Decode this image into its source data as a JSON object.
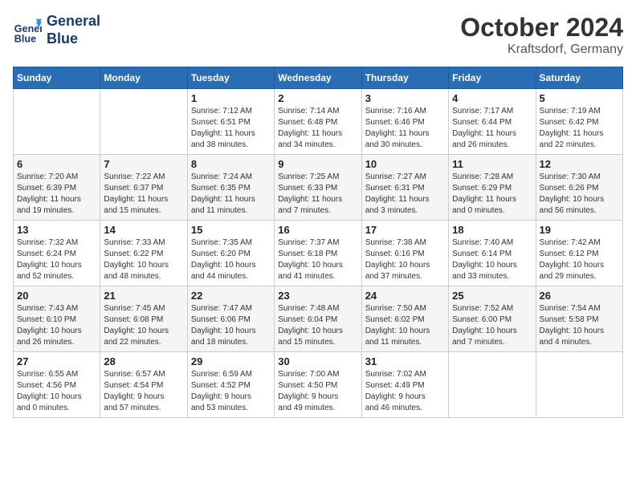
{
  "header": {
    "logo_line1": "General",
    "logo_line2": "Blue",
    "month_title": "October 2024",
    "location": "Kraftsdorf, Germany"
  },
  "weekdays": [
    "Sunday",
    "Monday",
    "Tuesday",
    "Wednesday",
    "Thursday",
    "Friday",
    "Saturday"
  ],
  "weeks": [
    [
      {
        "num": "",
        "info": ""
      },
      {
        "num": "",
        "info": ""
      },
      {
        "num": "1",
        "info": "Sunrise: 7:12 AM\nSunset: 6:51 PM\nDaylight: 11 hours\nand 38 minutes."
      },
      {
        "num": "2",
        "info": "Sunrise: 7:14 AM\nSunset: 6:48 PM\nDaylight: 11 hours\nand 34 minutes."
      },
      {
        "num": "3",
        "info": "Sunrise: 7:16 AM\nSunset: 6:46 PM\nDaylight: 11 hours\nand 30 minutes."
      },
      {
        "num": "4",
        "info": "Sunrise: 7:17 AM\nSunset: 6:44 PM\nDaylight: 11 hours\nand 26 minutes."
      },
      {
        "num": "5",
        "info": "Sunrise: 7:19 AM\nSunset: 6:42 PM\nDaylight: 11 hours\nand 22 minutes."
      }
    ],
    [
      {
        "num": "6",
        "info": "Sunrise: 7:20 AM\nSunset: 6:39 PM\nDaylight: 11 hours\nand 19 minutes."
      },
      {
        "num": "7",
        "info": "Sunrise: 7:22 AM\nSunset: 6:37 PM\nDaylight: 11 hours\nand 15 minutes."
      },
      {
        "num": "8",
        "info": "Sunrise: 7:24 AM\nSunset: 6:35 PM\nDaylight: 11 hours\nand 11 minutes."
      },
      {
        "num": "9",
        "info": "Sunrise: 7:25 AM\nSunset: 6:33 PM\nDaylight: 11 hours\nand 7 minutes."
      },
      {
        "num": "10",
        "info": "Sunrise: 7:27 AM\nSunset: 6:31 PM\nDaylight: 11 hours\nand 3 minutes."
      },
      {
        "num": "11",
        "info": "Sunrise: 7:28 AM\nSunset: 6:29 PM\nDaylight: 11 hours\nand 0 minutes."
      },
      {
        "num": "12",
        "info": "Sunrise: 7:30 AM\nSunset: 6:26 PM\nDaylight: 10 hours\nand 56 minutes."
      }
    ],
    [
      {
        "num": "13",
        "info": "Sunrise: 7:32 AM\nSunset: 6:24 PM\nDaylight: 10 hours\nand 52 minutes."
      },
      {
        "num": "14",
        "info": "Sunrise: 7:33 AM\nSunset: 6:22 PM\nDaylight: 10 hours\nand 48 minutes."
      },
      {
        "num": "15",
        "info": "Sunrise: 7:35 AM\nSunset: 6:20 PM\nDaylight: 10 hours\nand 44 minutes."
      },
      {
        "num": "16",
        "info": "Sunrise: 7:37 AM\nSunset: 6:18 PM\nDaylight: 10 hours\nand 41 minutes."
      },
      {
        "num": "17",
        "info": "Sunrise: 7:38 AM\nSunset: 6:16 PM\nDaylight: 10 hours\nand 37 minutes."
      },
      {
        "num": "18",
        "info": "Sunrise: 7:40 AM\nSunset: 6:14 PM\nDaylight: 10 hours\nand 33 minutes."
      },
      {
        "num": "19",
        "info": "Sunrise: 7:42 AM\nSunset: 6:12 PM\nDaylight: 10 hours\nand 29 minutes."
      }
    ],
    [
      {
        "num": "20",
        "info": "Sunrise: 7:43 AM\nSunset: 6:10 PM\nDaylight: 10 hours\nand 26 minutes."
      },
      {
        "num": "21",
        "info": "Sunrise: 7:45 AM\nSunset: 6:08 PM\nDaylight: 10 hours\nand 22 minutes."
      },
      {
        "num": "22",
        "info": "Sunrise: 7:47 AM\nSunset: 6:06 PM\nDaylight: 10 hours\nand 18 minutes."
      },
      {
        "num": "23",
        "info": "Sunrise: 7:48 AM\nSunset: 6:04 PM\nDaylight: 10 hours\nand 15 minutes."
      },
      {
        "num": "24",
        "info": "Sunrise: 7:50 AM\nSunset: 6:02 PM\nDaylight: 10 hours\nand 11 minutes."
      },
      {
        "num": "25",
        "info": "Sunrise: 7:52 AM\nSunset: 6:00 PM\nDaylight: 10 hours\nand 7 minutes."
      },
      {
        "num": "26",
        "info": "Sunrise: 7:54 AM\nSunset: 5:58 PM\nDaylight: 10 hours\nand 4 minutes."
      }
    ],
    [
      {
        "num": "27",
        "info": "Sunrise: 6:55 AM\nSunset: 4:56 PM\nDaylight: 10 hours\nand 0 minutes."
      },
      {
        "num": "28",
        "info": "Sunrise: 6:57 AM\nSunset: 4:54 PM\nDaylight: 9 hours\nand 57 minutes."
      },
      {
        "num": "29",
        "info": "Sunrise: 6:59 AM\nSunset: 4:52 PM\nDaylight: 9 hours\nand 53 minutes."
      },
      {
        "num": "30",
        "info": "Sunrise: 7:00 AM\nSunset: 4:50 PM\nDaylight: 9 hours\nand 49 minutes."
      },
      {
        "num": "31",
        "info": "Sunrise: 7:02 AM\nSunset: 4:49 PM\nDaylight: 9 hours\nand 46 minutes."
      },
      {
        "num": "",
        "info": ""
      },
      {
        "num": "",
        "info": ""
      }
    ]
  ]
}
